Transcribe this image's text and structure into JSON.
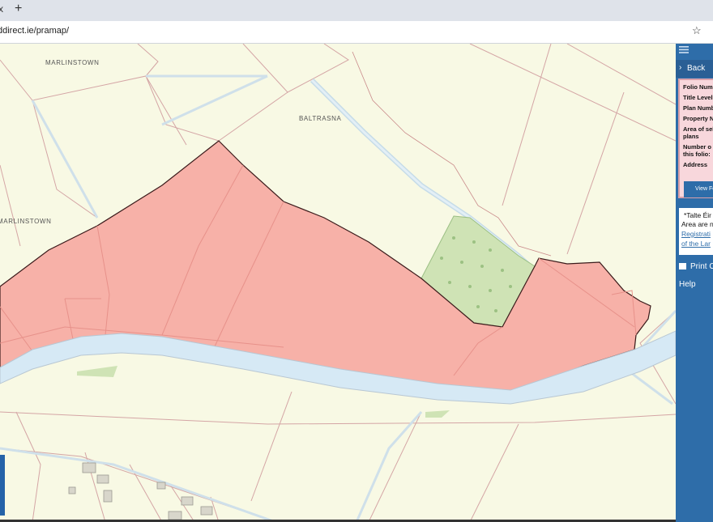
{
  "browser": {
    "tab_close": "x",
    "new_tab": "+",
    "url": "ddirect.ie/pramap/",
    "bookmark_icon": "star-icon"
  },
  "map": {
    "places": [
      "MARLINSTOWN",
      "BALTRASNA",
      "MARLINSTOWN"
    ],
    "colors": {
      "background": "#f8f9e4",
      "parcel_fill": "#f7b1a8",
      "parcel_outline": "#3a1a1a",
      "river": "#d6e9f5",
      "road": "#cfe0ea",
      "woodland": "#cfe3b5",
      "boundary": "#c98a8a"
    }
  },
  "panel": {
    "menu_icon": "hamburger-icon",
    "back": "Back",
    "fields": [
      "Folio Numb",
      "Title Level",
      "Plan Numb",
      "Property N",
      "Area of sel",
      "plans",
      "Number o",
      "this folio:",
      "Address"
    ],
    "view_button": "View Fo",
    "note_lines": [
      "*Talte Éir",
      "Area are n",
      "Registrati",
      "of the Lar"
    ],
    "print": "Print O",
    "help": "Help",
    "colors": {
      "panel": "#2e6da9",
      "info_bg": "#f8d7dc"
    }
  }
}
